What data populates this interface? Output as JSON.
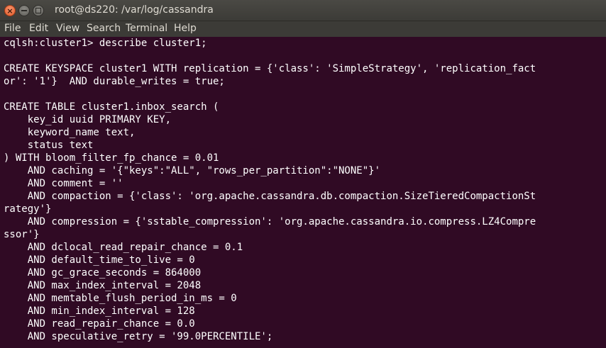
{
  "window": {
    "title": "root@ds220: /var/log/cassandra",
    "close_glyph": "×"
  },
  "menubar": {
    "items": [
      "File",
      "Edit",
      "View",
      "Search",
      "Terminal",
      "Help"
    ]
  },
  "colors": {
    "terminal_bg": "#300a24",
    "terminal_fg": "#ffffff",
    "titlebar_bg": "#3c3b37",
    "close_button": "#e35c2b"
  },
  "icons": {
    "close": "close-icon",
    "minimize": "minimize-icon",
    "maximize": "maximize-icon"
  },
  "terminal": {
    "lines": [
      "cqlsh:cluster1> describe cluster1;",
      "",
      "CREATE KEYSPACE cluster1 WITH replication = {'class': 'SimpleStrategy', 'replication_fact",
      "or': '1'}  AND durable_writes = true;",
      "",
      "CREATE TABLE cluster1.inbox_search (",
      "    key_id uuid PRIMARY KEY,",
      "    keyword_name text,",
      "    status text",
      ") WITH bloom_filter_fp_chance = 0.01",
      "    AND caching = '{\"keys\":\"ALL\", \"rows_per_partition\":\"NONE\"}'",
      "    AND comment = ''",
      "    AND compaction = {'class': 'org.apache.cassandra.db.compaction.SizeTieredCompactionSt",
      "rategy'}",
      "    AND compression = {'sstable_compression': 'org.apache.cassandra.io.compress.LZ4Compre",
      "ssor'}",
      "    AND dclocal_read_repair_chance = 0.1",
      "    AND default_time_to_live = 0",
      "    AND gc_grace_seconds = 864000",
      "    AND max_index_interval = 2048",
      "    AND memtable_flush_period_in_ms = 0",
      "    AND min_index_interval = 128",
      "    AND read_repair_chance = 0.0",
      "    AND speculative_retry = '99.0PERCENTILE';"
    ]
  }
}
